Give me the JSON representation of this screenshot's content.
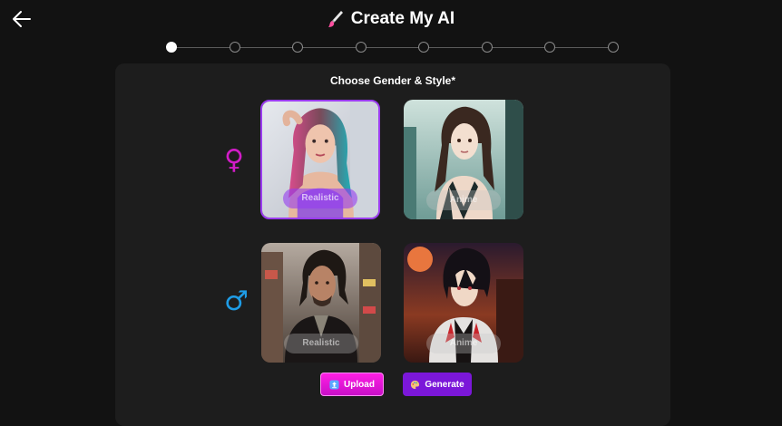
{
  "header": {
    "title": "Create My AI",
    "back_icon": "arrow-left-icon",
    "title_icon": "paintbrush-icon"
  },
  "stepper": {
    "total_steps": 8,
    "current_step": 1
  },
  "panel": {
    "title": "Choose Gender & Style*",
    "genders": [
      {
        "name": "female",
        "icon": "female-symbol-icon",
        "color": "#d21cc8",
        "options": [
          {
            "label": "Realistic",
            "selected": true
          },
          {
            "label": "Anime",
            "selected": false
          }
        ]
      },
      {
        "name": "male",
        "icon": "male-symbol-icon",
        "color": "#1e9ce6",
        "options": [
          {
            "label": "Realistic",
            "selected": false
          },
          {
            "label": "Anime",
            "selected": false
          }
        ]
      }
    ]
  },
  "actions": {
    "upload_label": "Upload",
    "generate_label": "Generate",
    "upload_color": "#ff1fe4",
    "generate_color": "#7b17d9"
  },
  "colors": {
    "background": "#121212",
    "panel": "#1d1d1d",
    "accent": "#9b3cf0"
  }
}
